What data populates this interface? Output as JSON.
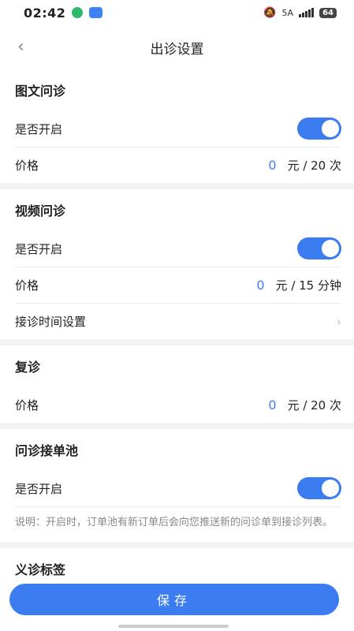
{
  "status": {
    "time": "02:42",
    "network": "5A",
    "battery": "64"
  },
  "nav": {
    "title": "出诊设置"
  },
  "sections": [
    {
      "title": "图文问诊",
      "enable_label": "是否开启",
      "enabled": true,
      "price_label": "价格",
      "price_value": "0",
      "price_unit": "元 / 20 次"
    },
    {
      "title": "视频问诊",
      "enable_label": "是否开启",
      "enabled": true,
      "price_label": "价格",
      "price_value": "0",
      "price_unit": "元 / 15 分钟",
      "schedule_label": "接诊时间设置"
    },
    {
      "title": "复诊",
      "price_label": "价格",
      "price_value": "0",
      "price_unit": "元 / 20 次"
    },
    {
      "title": "问诊接单池",
      "enable_label": "是否开启",
      "enabled": true,
      "note": "说明：开启时，订单池有新订单后会向您推送新的问诊单到接诊列表。"
    },
    {
      "title": "义诊标签"
    }
  ],
  "footer": {
    "save_label": "保存"
  }
}
